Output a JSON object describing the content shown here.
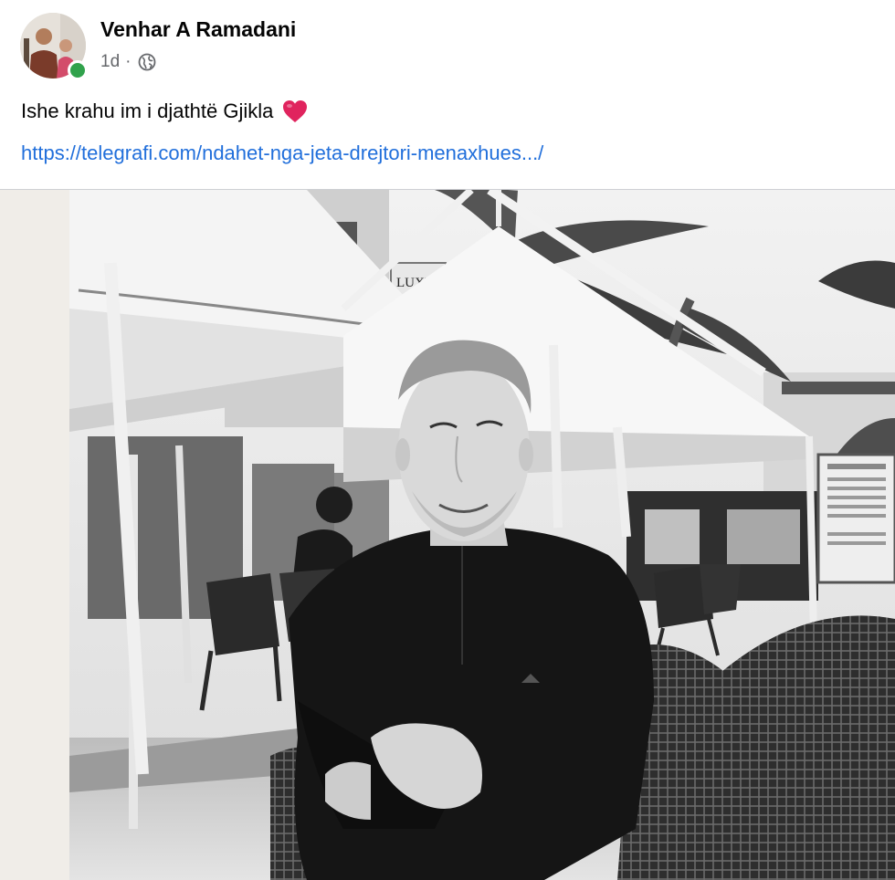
{
  "post": {
    "author": "Venhar A Ramadani",
    "timestamp": "1d",
    "separator": "·",
    "audience_icon": "globe-icon",
    "caption": "Ishe krahu im i djathtë Gjikla",
    "caption_emoji": "heart-emoji-icon",
    "link_text": "https://telegrafi.com/ndahet-nga-jeta-drejtori-menaxhues.../",
    "online_status": "online",
    "sign_text": "LUXURY"
  },
  "colors": {
    "link": "#216fdb",
    "online": "#31a24c",
    "heart": "#e0245e",
    "author_text": "#050505",
    "meta_text": "#65676b"
  }
}
